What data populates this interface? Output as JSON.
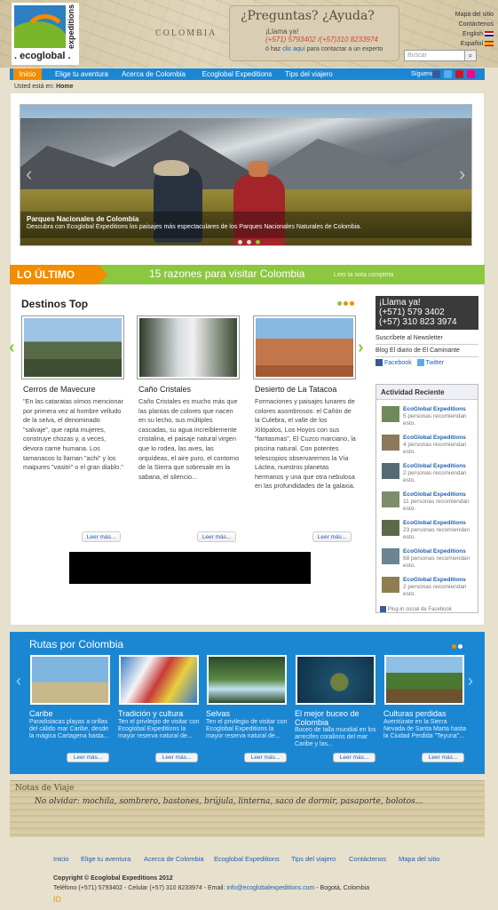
{
  "header": {
    "logo_text": ". ecoglobal .",
    "logo_vertical": "expeditions",
    "map_label": "COLOMBIA",
    "help": {
      "title": "¿Preguntas? ¿Ayuda?",
      "call": "¡Llama ya!",
      "phones": "(+571) 5793402  /(+57)310 8233974",
      "contact_prefix": "ó haz ",
      "contact_link": "clic aquí",
      "contact_suffix": " para contactar a un experto"
    },
    "top_links": [
      "Mapa del sitio",
      "Contáctenos",
      "English",
      "Español"
    ],
    "search_placeholder": "Buscar",
    "search_icon": "magnifier-icon"
  },
  "nav": {
    "items": [
      "Inicio",
      "Elige tu aventura",
      "Acerca de Colombia",
      "Ecoglobal Expeditions",
      "Tips del viajero"
    ],
    "social_label": "Síguenos",
    "social_icons": [
      "facebook-icon",
      "twitter-icon",
      "youtube-icon",
      "flickr-icon"
    ]
  },
  "breadcrumb": {
    "prefix": "Usted está en:",
    "current": "Home"
  },
  "slider": {
    "title": "Parques Nacionales de Colombia",
    "description": "Descubra con Ecoglobal Expeditions los paisajes más espectaculares de los Parques Nacionales Naturales de Colombia.",
    "prev": "‹",
    "next": "›"
  },
  "latest": {
    "tag": "LO ÚLTIMO",
    "headline": "15 razones para visitar Colombia",
    "link": "Leer la nota completa"
  },
  "destinos": {
    "title": "Destinos Top",
    "items": [
      {
        "title": "Cerros de Mavecure",
        "text": "\"En las cataratas oímos mencionar por primera vez al hombre velludo de la selva, el denominado \"salvaje\", que rapta mujeres, construye chozas y, a veces, devora carne humana. Los tamanacos lo llaman \"achi\" y los maipures \"vasitri\" o el gran diablo.\"",
        "more": "Leer más..."
      },
      {
        "title": "Caño Cristales",
        "text": "Caño Cristales es mucho más que las plantas de colores que nacen en su lecho, sus múltiples cascadas, su agua increíblemente cristalina, el paisaje natural virgen que lo rodea, las aves, las orquídeas, el aire puro, el contorno de la Sierra que sobresale en la sabana, el silencio...",
        "more": "Leer más..."
      },
      {
        "title": "Desierto de La Tatacoa",
        "text": "Formaciones y paisajes lunares de colores asombrosos: el Cañón de la Culebra, el valle de los Xilópalos, Los Hoyos con sus \"fantasmas\", El Cuzco marciano, la piscina natural. Con potentes telescopios observaremos la Vía Láctea, nuestros planetas hermanos y una que otra nebulosa en las profundidades de la galaxia.",
        "more": "Leer más..."
      }
    ]
  },
  "sidebar": {
    "call_title": "¡Llama ya!",
    "call_phone1": "(+571) 579 3402",
    "call_phone2": "(+57) 310 823 3974",
    "links": [
      "Suscríbete al Newsletter",
      "Blog El diario de El Caminante"
    ],
    "facebook": "Facebook",
    "twitter": "Twitter",
    "activity_title": "Actividad Reciente",
    "activity": [
      {
        "name": "EcoGlobal Expeditions",
        "desc": "5 personas recomiendan esto."
      },
      {
        "name": "EcoGlobal Expeditions",
        "desc": "4 personas recomiendan esto."
      },
      {
        "name": "EcoGlobal Expeditions",
        "desc": "2 personas recomiendan esto."
      },
      {
        "name": "EcoGlobal Expeditions",
        "desc": "11 personas recomiendan esto."
      },
      {
        "name": "EcoGlobal Expeditions",
        "desc": "23 personas recomiendan esto."
      },
      {
        "name": "EcoGlobal Expeditions",
        "desc": "68 personas recomiendan esto."
      },
      {
        "name": "EcoGlobal Expeditions",
        "desc": "2 personas recomiendan esto."
      }
    ],
    "plugin": "Plug-in social de Facebook"
  },
  "rutas": {
    "title": "Rutas por Colombia",
    "items": [
      {
        "title": "Caribe",
        "text": "Paradisiacas playas a orillas del cálido mar Caribe, desde la mágica Cartagena hasta...",
        "more": "Leer más..."
      },
      {
        "title": "Tradición y cultura",
        "text": "Ten el privilegio de visitar con Ecoglobal Expeditions la mayor reserva natural de...",
        "more": "Leer más..."
      },
      {
        "title": "Selvas",
        "text": "Ten el privilegio de visitar con Ecoglobal Expeditions la mayor reserva natural de...",
        "more": "Leer más..."
      },
      {
        "title": "El mejor buceo de Colombia",
        "text": "Buceo de talla mundial en los arrecifes coralinos del mar Caribe y las...",
        "more": "Leer más..."
      },
      {
        "title": "Culturas perdidas",
        "text": "Aventúrate en la Sierra Nevada de Santa Marta hasta la Ciudad Perdida \"Teyuna\"...",
        "more": "Leer más..."
      }
    ]
  },
  "notas": {
    "title": "Notas de Viaje",
    "text": "No olvidar: mochila, sombrero, bastones, brújula, linterna, saco de dormir, pasaporte, bolotos..."
  },
  "footer": {
    "nav": [
      "Inicio",
      "Elige tu aventura",
      "Acerca de Colombia",
      "Ecoglobal Expeditions",
      "Tips del viajero",
      "Contáctenos",
      "Mapa del sitio"
    ],
    "copyright": "Copyright © Ecoglobal Expeditions 2012",
    "contact_prefix": "Teléfono (+571) 5793402 - Celular (+57) 310 8233974 - Email: ",
    "email": "info@ecoglobalexpeditions.com",
    "contact_suffix": " - Bogotá, Colombia",
    "logo": "ID"
  },
  "colors": {
    "accent_orange": "#f28c00",
    "accent_green": "#8bc73f",
    "nav_blue": "#1b87d3"
  }
}
